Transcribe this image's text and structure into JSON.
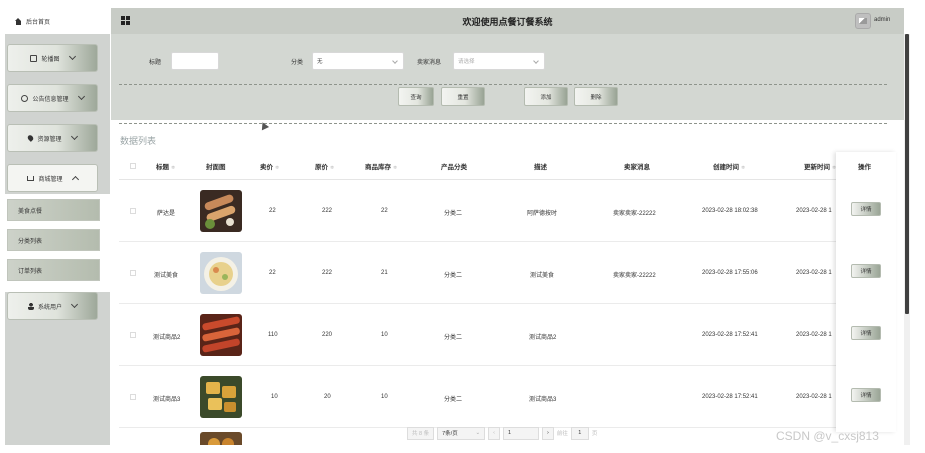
{
  "sidebar": {
    "home_label": "后台首页",
    "menus": [
      {
        "label": "轮播图",
        "icon": "image-icon"
      },
      {
        "label": "公告信息管理",
        "icon": "info-icon"
      },
      {
        "label": "资源管理",
        "icon": "location-icon"
      },
      {
        "label": "商城管理",
        "icon": "cart-icon",
        "expanded": true
      },
      {
        "label": "系统用户",
        "icon": "user-icon"
      }
    ],
    "submenu": [
      "美食点餐",
      "分类列表",
      "订单列表"
    ]
  },
  "header": {
    "title": "欢迎使用点餐订餐系统",
    "user": "admin"
  },
  "search": {
    "title_label": "标题",
    "title_value": "",
    "category_label": "分类",
    "category_value": "无",
    "seller_label": "卖家消息",
    "seller_placeholder": "请选择",
    "buttons": [
      "查询",
      "重置",
      "添加",
      "删除"
    ]
  },
  "section_title": "数据列表",
  "table": {
    "columns": [
      "标题",
      "封面图",
      "卖价",
      "原价",
      "商品库存",
      "产品分类",
      "描述",
      "卖家消息",
      "创建时间",
      "更新时间",
      "操作"
    ],
    "rows": [
      {
        "title": "萨达是",
        "price": "22",
        "original": "222",
        "stock": "22",
        "category": "分类二",
        "desc": "阿萨德按时",
        "seller": "卖家卖家-22222",
        "created": "2023-02-28 18:02:38",
        "updated": "2023-02-28 1",
        "action": "详情"
      },
      {
        "title": "测试美食",
        "price": "22",
        "original": "222",
        "stock": "21",
        "category": "分类二",
        "desc": "测试美食",
        "seller": "卖家卖家-22222",
        "created": "2023-02-28 17:55:06",
        "updated": "2023-02-28 1",
        "action": "详情"
      },
      {
        "title": "测试商品2",
        "price": "110",
        "original": "220",
        "stock": "10",
        "category": "分类二",
        "desc": "测试商品2",
        "seller": "",
        "created": "2023-02-28 17:52:41",
        "updated": "2023-02-28 1",
        "action": "详情"
      },
      {
        "title": "测试商品3",
        "price": "10",
        "original": "20",
        "stock": "10",
        "category": "分类二",
        "desc": "测试商品3",
        "seller": "",
        "created": "2023-02-28 17:52:41",
        "updated": "2023-02-28 1",
        "action": "详情"
      }
    ]
  },
  "pagination": {
    "total": "共 8 条",
    "page_size": "7条/页",
    "current_page": "1",
    "goto_label": "前往",
    "goto_value": "1",
    "page_suffix": "页"
  },
  "watermark": "CSDN @v_cxsj813"
}
